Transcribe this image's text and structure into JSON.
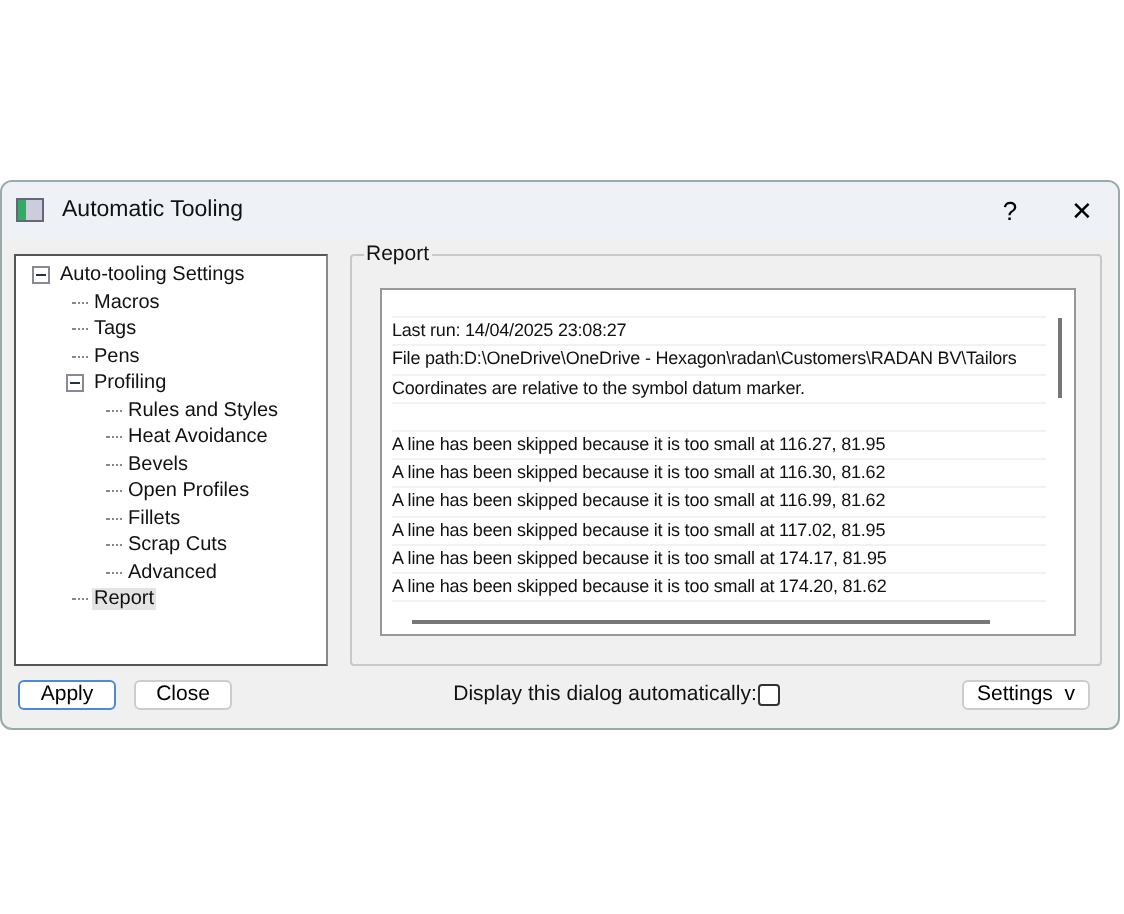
{
  "window": {
    "title": "Automatic Tooling",
    "help": "?",
    "close": "✕"
  },
  "tree": [
    {
      "label": "Auto-tooling Settings",
      "expanded": true,
      "selected": false,
      "children": [
        {
          "label": "Macros",
          "selected": false
        },
        {
          "label": "Tags",
          "selected": false
        },
        {
          "label": "Pens",
          "selected": false
        },
        {
          "label": "Profiling",
          "expanded": true,
          "selected": false,
          "children": [
            {
              "label": "Rules and Styles",
              "selected": false
            },
            {
              "label": "Heat Avoidance",
              "selected": false
            },
            {
              "label": "Bevels",
              "selected": false
            },
            {
              "label": "Open Profiles",
              "selected": false
            },
            {
              "label": "Fillets",
              "selected": false
            },
            {
              "label": "Scrap Cuts",
              "selected": false
            },
            {
              "label": "Advanced",
              "selected": false
            }
          ]
        },
        {
          "label": "Report",
          "selected": true
        }
      ]
    }
  ],
  "report": {
    "title": "Report",
    "header": [
      "Last run: 14/04/2025 23:08:27",
      "File path:D:\\OneDrive\\OneDrive - Hexagon\\radan\\Customers\\RADAN BV\\Tailors",
      "Coordinates are relative to the symbol datum marker."
    ],
    "entries": [
      "A line has been skipped because it is too small at 116.27, 81.95",
      "A line has been skipped because it is too small at 116.30, 81.62",
      "A line has been skipped because it is too small at 116.99, 81.62",
      "A line has been skipped because it is too small at 117.02, 81.95",
      "A line has been skipped because it is too small at 174.17, 81.95",
      "A line has been skipped because it is too small at 174.20, 81.62"
    ]
  },
  "buttons": {
    "apply": "Apply",
    "close": "Close",
    "settings": "Settings",
    "settings_caret": "v"
  },
  "auto_display": {
    "label": "Display this dialog automatically:",
    "checked": false
  }
}
